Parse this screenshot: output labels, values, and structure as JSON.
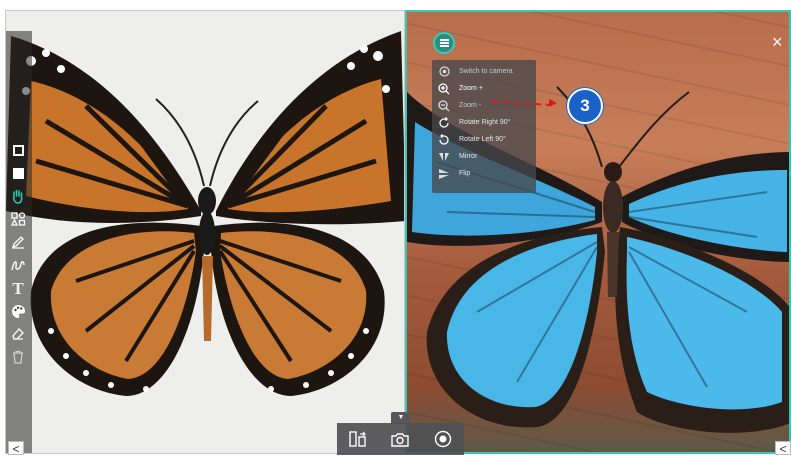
{
  "menu": {
    "button_icon": "hamburger-menu-icon",
    "items": [
      {
        "label": "Switch to camera",
        "icon": "camera-switch-icon",
        "state": "dim"
      },
      {
        "label": "Zoom +",
        "icon": "zoom-in-icon",
        "state": "normal"
      },
      {
        "label": "Zoom -",
        "icon": "zoom-out-icon",
        "state": "dim"
      },
      {
        "label": "Rotate Right 90°",
        "icon": "rotate-right-icon",
        "state": "normal"
      },
      {
        "label": "Rotate Left 90°",
        "icon": "rotate-left-icon",
        "state": "normal"
      },
      {
        "label": "Mirror",
        "icon": "mirror-icon",
        "state": "normal"
      },
      {
        "label": "Flip",
        "icon": "flip-icon",
        "state": "normal"
      }
    ]
  },
  "callout": {
    "number": "3",
    "color": "#1b62c8"
  },
  "toolbar": {
    "tools": [
      "window-icon",
      "fullscreen-icon",
      "hand-pan-icon",
      "shapes-icon",
      "pen-icon",
      "freehand-icon",
      "text-icon",
      "palette-icon",
      "eraser-icon",
      "trash-icon"
    ],
    "text_tool_glyph": "T",
    "active_tool": "hand-pan-icon",
    "accent": "#2fc4ad"
  },
  "bottom_bar": {
    "buttons": [
      "split-layout-icon",
      "camera-capture-icon",
      "record-icon"
    ]
  },
  "nav": {
    "left_arrow": "<",
    "right_arrow": "<",
    "close": "×"
  },
  "colors": {
    "panel_border": "#3ec4b2",
    "arrow": "#e01818"
  }
}
